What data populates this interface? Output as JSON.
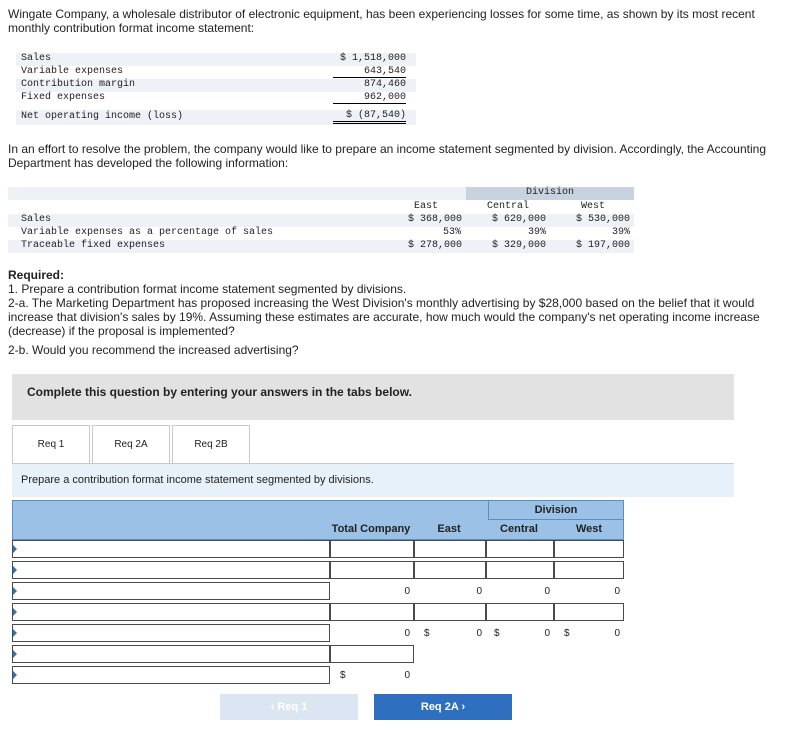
{
  "intro": "Wingate Company, a wholesale distributor of electronic equipment, has been experiencing losses for some time, as shown by its most recent monthly contribution format income statement:",
  "statement": {
    "rows": [
      {
        "label": "Sales",
        "value": "$ 1,518,000"
      },
      {
        "label": "Variable expenses",
        "value": "643,540"
      },
      {
        "label": "Contribution margin",
        "value": "874,460"
      },
      {
        "label": "Fixed expenses",
        "value": "962,000"
      },
      {
        "label": "Net operating income (loss)",
        "value": "$ (87,540)"
      }
    ]
  },
  "para2": "In an effort to resolve the problem, the company would like to prepare an income statement segmented by division. Accordingly, the Accounting Department has developed the following information:",
  "division_info": {
    "group_header": "Division",
    "columns": [
      "East",
      "Central",
      "West"
    ],
    "rows": [
      {
        "label": "Sales",
        "values": [
          "$ 368,000",
          "$ 620,000",
          "$ 530,000"
        ]
      },
      {
        "label": "Variable expenses as a percentage of sales",
        "values": [
          "53%",
          "39%",
          "39%"
        ]
      },
      {
        "label": "Traceable fixed expenses",
        "values": [
          "$ 278,000",
          "$ 329,000",
          "$ 197,000"
        ]
      }
    ]
  },
  "required": {
    "heading": "Required:",
    "items": [
      "1. Prepare a contribution format income statement segmented by divisions.",
      "2-a. The Marketing Department has proposed increasing the West Division's monthly advertising by $28,000 based on the belief that it would increase that division's sales by 19%. Assuming these estimates are accurate, how much would the company's net operating income increase (decrease) if the proposal is implemented?",
      "2-b. Would you recommend the increased advertising?"
    ]
  },
  "banner": "Complete this question by entering your answers in the tabs below.",
  "tabs": [
    "Req 1",
    "Req 2A",
    "Req 2B"
  ],
  "panel_instruction": "Prepare a contribution format income statement segmented by divisions.",
  "answer_table": {
    "group_header": "Division",
    "columns": [
      "Total Company",
      "East",
      "Central",
      "West"
    ],
    "row4": [
      "0",
      "0",
      "0",
      "0"
    ],
    "row6": [
      "0",
      "0",
      "0",
      "0"
    ],
    "row9_total": "0",
    "dollar": "$"
  },
  "nav": {
    "prev": "Req 1",
    "next": "Req 2A"
  },
  "colors": {
    "header_blue": "#9bc2e6",
    "button_blue": "#2e6fbf",
    "panel_blue": "#e6f1fa"
  }
}
